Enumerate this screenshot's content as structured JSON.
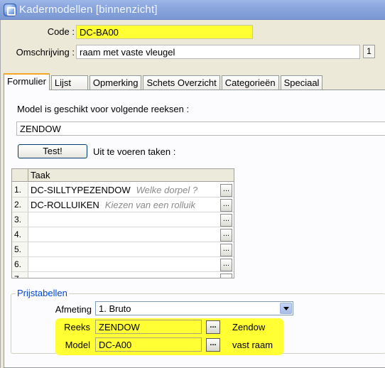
{
  "window": {
    "title": "Kadermodellen [binnenzicht]",
    "icon": "app-icon"
  },
  "header": {
    "code_label": "Code :",
    "code_value": "DC-BA00",
    "omschrijving_label": "Omschrijving :",
    "omschrijving_value": "raam met vaste vleugel",
    "lang_count": "1"
  },
  "tabs": [
    {
      "label": "Formulier",
      "active": true
    },
    {
      "label": "Lijst"
    },
    {
      "label": "Opmerking"
    },
    {
      "label": "Schets Overzicht"
    },
    {
      "label": "Categorieën"
    },
    {
      "label": "Speciaal"
    }
  ],
  "form": {
    "series_label": "Model is geschikt voor volgende reeksen :",
    "series_value": "ZENDOW",
    "test_button": "Test!",
    "tasks_label": "Uit te voeren taken :"
  },
  "task_grid": {
    "column": "Taak",
    "ellipsis": "...",
    "rows": [
      {
        "num": "1.",
        "task": "DC-SILLTYPEZENDOW",
        "hint": "Welke dorpel ?"
      },
      {
        "num": "2.",
        "task": "DC-ROLLUIKEN",
        "hint": "Kiezen van een rolluik"
      },
      {
        "num": "3.",
        "task": "",
        "hint": ""
      },
      {
        "num": "4.",
        "task": "",
        "hint": ""
      },
      {
        "num": "5.",
        "task": "",
        "hint": ""
      },
      {
        "num": "6.",
        "task": "",
        "hint": ""
      },
      {
        "num": "7.",
        "task": "",
        "hint": ""
      }
    ]
  },
  "prijstabellen": {
    "title": "Prijstabellen",
    "afmeting_label": "Afmeting",
    "afmeting_value": "1.  Bruto",
    "reeks_label": "Reeks",
    "reeks_value": "ZENDOW",
    "reeks_desc": "Zendow",
    "model_label": "Model",
    "model_value": "DC-A00",
    "model_desc": "vast raam",
    "ellipsis": "..."
  },
  "colors": {
    "highlight": "#ffff33",
    "tab_accent": "#f5a623",
    "group_title": "#0046d5"
  }
}
